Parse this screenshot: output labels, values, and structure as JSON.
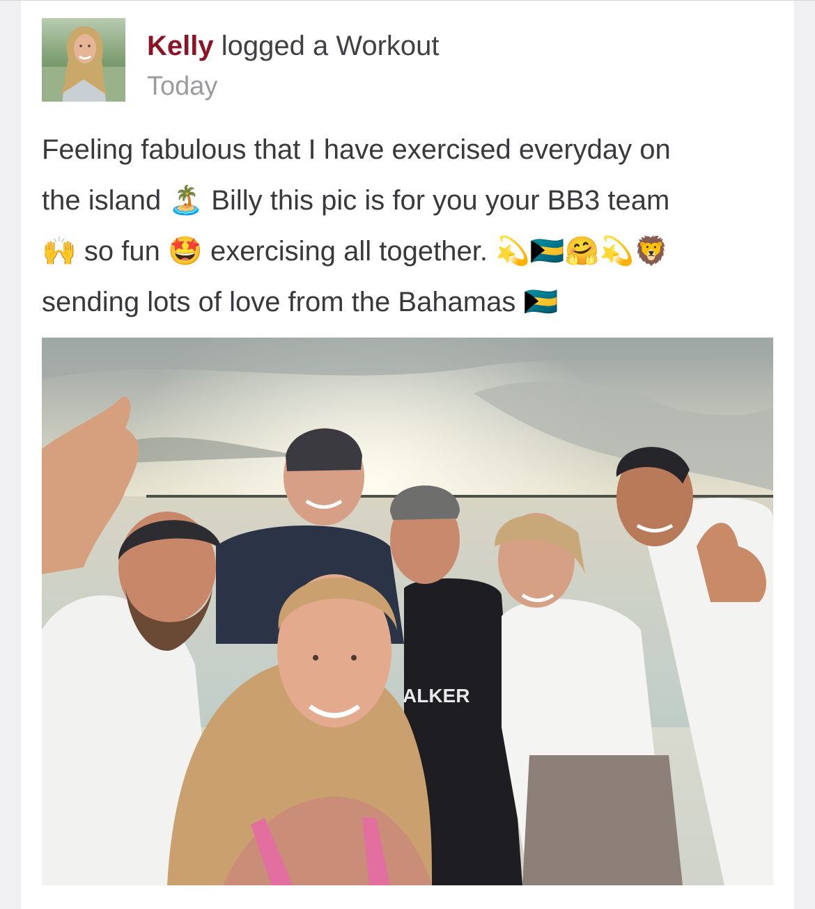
{
  "post": {
    "author": "Kelly",
    "action": " logged a Workout",
    "timestamp": "Today",
    "lines": [
      [
        {
          "t": "Feeling fabulous that I have exercised everyday on"
        }
      ],
      [
        {
          "t": "the island "
        },
        {
          "e": "🏝️",
          "name": "desert-island-emoji"
        },
        {
          "t": " Billy this pic is for you your BB3 team"
        }
      ],
      [
        {
          "e": "🙌",
          "name": "raising-hands-emoji"
        },
        {
          "t": " so fun "
        },
        {
          "e": "🤩",
          "name": "star-struck-emoji"
        },
        {
          "t": " exercising all together. "
        },
        {
          "e": "💫",
          "name": "dizzy-emoji"
        },
        {
          "e": "🇧🇸",
          "name": "bahamas-flag-emoji"
        },
        {
          "e": "🤗",
          "name": "hugging-face-emoji"
        },
        {
          "e": "💫",
          "name": "dizzy-emoji"
        },
        {
          "e": "🦁",
          "name": "lion-emoji"
        }
      ],
      [
        {
          "t": "sending lots of love from the Bahamas "
        },
        {
          "e": "🇧🇸",
          "name": "bahamas-flag-emoji"
        }
      ]
    ],
    "photo_text": "ALKER"
  },
  "colors": {
    "author": "#8b1526",
    "body_text": "#38383d",
    "timestamp": "#9c9ca0",
    "page_background": "#f0f0f2",
    "card_background": "#ffffff"
  },
  "icons": {
    "avatar": "profile-photo",
    "photo": "group-selfie-beach-photo"
  }
}
